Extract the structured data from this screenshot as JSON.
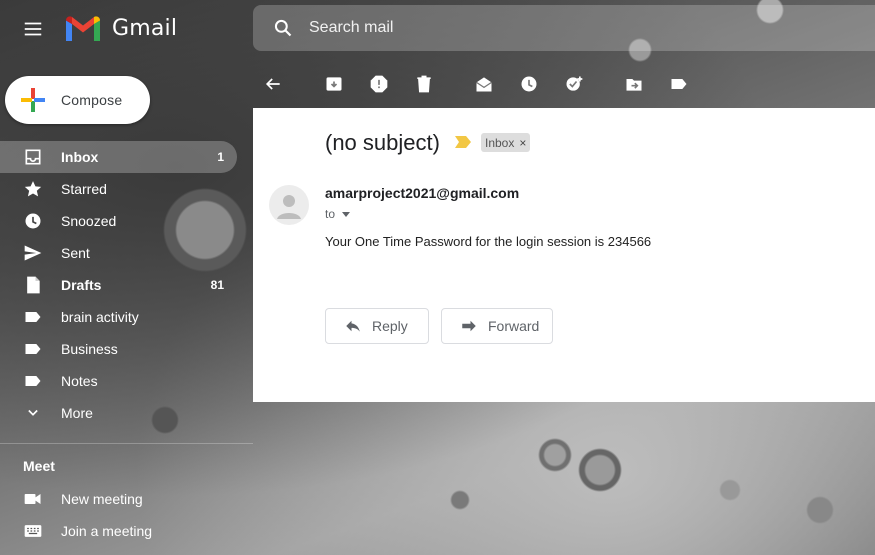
{
  "header": {
    "logo_text": "Gmail",
    "search_placeholder": "Search mail"
  },
  "sidebar": {
    "compose_label": "Compose",
    "items": [
      {
        "label": "Inbox",
        "count": "1",
        "icon": "inbox-icon"
      },
      {
        "label": "Starred",
        "count": "",
        "icon": "star-icon"
      },
      {
        "label": "Snoozed",
        "count": "",
        "icon": "clock-icon"
      },
      {
        "label": "Sent",
        "count": "",
        "icon": "send-icon"
      },
      {
        "label": "Drafts",
        "count": "81",
        "icon": "draft-icon"
      },
      {
        "label": "brain activity",
        "count": "",
        "icon": "label-icon"
      },
      {
        "label": "Business",
        "count": "",
        "icon": "label-icon"
      },
      {
        "label": "Notes",
        "count": "",
        "icon": "label-icon"
      },
      {
        "label": "More",
        "count": "",
        "icon": "chevron-down-icon"
      }
    ]
  },
  "meet": {
    "title": "Meet",
    "items": [
      {
        "label": "New meeting",
        "icon": "video-icon"
      },
      {
        "label": "Join a meeting",
        "icon": "keyboard-icon"
      }
    ]
  },
  "toolbar": {
    "icons": [
      "back-icon",
      "archive-icon",
      "report-spam-icon",
      "delete-icon",
      "mark-unread-icon",
      "snooze-icon",
      "add-task-icon",
      "move-to-icon",
      "labels-icon"
    ]
  },
  "message": {
    "subject": "(no subject)",
    "label_chip": "Inbox",
    "chip_close": "×",
    "sender": "amarproject2021@gmail.com",
    "to": "to",
    "body": "Your One Time Password for the login session is 234566",
    "reply_label": "Reply",
    "forward_label": "Forward"
  },
  "colors": {
    "importance_marker": "#f2c744",
    "active_nav_bg": "rgba(255,255,255,0.25)"
  }
}
